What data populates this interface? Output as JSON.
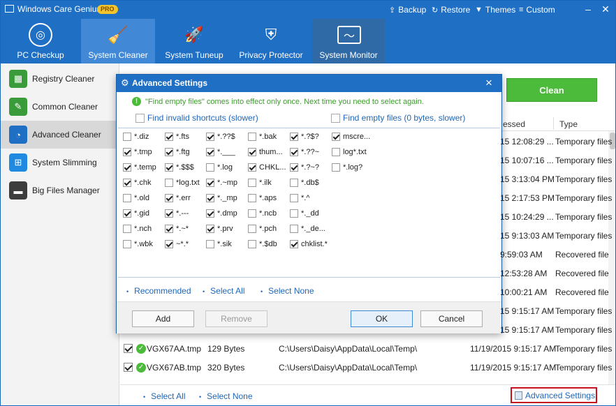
{
  "app": {
    "title": "Windows Care Genius",
    "badge": "PRO",
    "top_links": [
      {
        "label": "Backup",
        "icon": "upload-icon"
      },
      {
        "label": "Restore",
        "icon": "restore-icon"
      },
      {
        "label": "Themes",
        "icon": "shirt-icon"
      },
      {
        "label": "Custom",
        "icon": "list-icon"
      }
    ],
    "accent": "#1f6fc5"
  },
  "nav": {
    "tabs": [
      {
        "label": "PC Checkup",
        "icon": "radar-icon"
      },
      {
        "label": "System Cleaner",
        "icon": "broom-icon"
      },
      {
        "label": "System Tuneup",
        "icon": "rocket-icon"
      },
      {
        "label": "Privacy Protector",
        "icon": "shield-icon"
      },
      {
        "label": "System Monitor",
        "icon": "monitor-icon"
      }
    ]
  },
  "sidebar": {
    "items": [
      {
        "label": "Registry Cleaner",
        "icon": "grid-icon"
      },
      {
        "label": "Common Cleaner",
        "icon": "brush-icon"
      },
      {
        "label": "Advanced Cleaner",
        "icon": "wifi-icon"
      },
      {
        "label": "System Slimming",
        "icon": "windows-icon"
      },
      {
        "label": "Big Files Manager",
        "icon": "folder-icon"
      }
    ]
  },
  "main": {
    "clean_label": "Clean",
    "columns": {
      "accessed": "essed",
      "type": "Type"
    },
    "rows": [
      {
        "date": "15 12:08:29 ...",
        "type": "Temporary files"
      },
      {
        "date": "15 10:07:16 ...",
        "type": "Temporary files"
      },
      {
        "date": "15 3:13:04 PM",
        "type": "Temporary files"
      },
      {
        "date": "15 2:17:53 PM",
        "type": "Temporary files"
      },
      {
        "date": "15 10:24:29 ...",
        "type": "Temporary files"
      },
      {
        "date": "15 9:13:03 AM",
        "type": "Temporary files"
      },
      {
        "date": "9:59:03 AM",
        "type": "Recovered file"
      },
      {
        "date": "12:53:28 AM",
        "type": "Recovered file"
      },
      {
        "date": "10:00:21 AM",
        "type": "Recovered file"
      },
      {
        "date": "15 9:15:17 AM",
        "type": "Temporary files"
      },
      {
        "date": "15 9:15:17 AM",
        "type": "Temporary files"
      }
    ],
    "file_rows": [
      {
        "name": "VGX67AA.tmp",
        "size": "129 Bytes",
        "path": "C:\\Users\\Daisy\\AppData\\Local\\Temp\\",
        "date": "11/19/2015 9:15:17 AM",
        "type": "Temporary files"
      },
      {
        "name": "VGX67AB.tmp",
        "size": "320 Bytes",
        "path": "C:\\Users\\Daisy\\AppData\\Local\\Temp\\",
        "date": "11/19/2015 9:15:17 AM",
        "type": "Temporary files"
      }
    ],
    "select_all": "Select All",
    "select_none": "Select None",
    "advanced_settings": "Advanced Settings"
  },
  "dialog": {
    "title": "Advanced Settings",
    "notice": "\"Find empty files\" comes into effect only once. Next time you need to select again.",
    "opt_shortcuts": "Find invalid shortcuts (slower)",
    "opt_empty": "Find empty files (0 bytes, slower)",
    "patterns": [
      [
        {
          "l": "*.diz",
          "c": false
        },
        {
          "l": "*.fts",
          "c": true
        },
        {
          "l": "*.??$",
          "c": true
        },
        {
          "l": "*.bak",
          "c": false
        },
        {
          "l": "*.?$?",
          "c": true
        },
        {
          "l": "mscre...",
          "c": true
        }
      ],
      [
        {
          "l": "*.tmp",
          "c": true
        },
        {
          "l": "*.ftg",
          "c": true
        },
        {
          "l": "*.___",
          "c": true
        },
        {
          "l": "thum...",
          "c": true
        },
        {
          "l": "*.??~",
          "c": true
        },
        {
          "l": "log*.txt",
          "c": false
        }
      ],
      [
        {
          "l": "*.temp",
          "c": true
        },
        {
          "l": "*.$$$",
          "c": true
        },
        {
          "l": "*.log",
          "c": false
        },
        {
          "l": "CHKL...",
          "c": true
        },
        {
          "l": "*.?~?",
          "c": true
        },
        {
          "l": "*.log?",
          "c": false
        }
      ],
      [
        {
          "l": "*.chk",
          "c": true
        },
        {
          "l": "*log.txt",
          "c": false
        },
        {
          "l": "*.~mp",
          "c": true
        },
        {
          "l": "*.ilk",
          "c": false
        },
        {
          "l": "*.db$",
          "c": false
        }
      ],
      [
        {
          "l": "*.old",
          "c": false
        },
        {
          "l": "*.err",
          "c": true
        },
        {
          "l": "*._mp",
          "c": true
        },
        {
          "l": "*.aps",
          "c": false
        },
        {
          "l": "*.^",
          "c": false
        }
      ],
      [
        {
          "l": "*.gid",
          "c": true
        },
        {
          "l": "*.---",
          "c": true
        },
        {
          "l": "*.dmp",
          "c": true
        },
        {
          "l": "*.ncb",
          "c": false
        },
        {
          "l": "*._dd",
          "c": false
        }
      ],
      [
        {
          "l": "*.nch",
          "c": false
        },
        {
          "l": "*.~*",
          "c": true
        },
        {
          "l": "*.prv",
          "c": true
        },
        {
          "l": "*.pch",
          "c": false
        },
        {
          "l": "*._de...",
          "c": false
        }
      ],
      [
        {
          "l": "*.wbk",
          "c": false
        },
        {
          "l": "~*.*",
          "c": true
        },
        {
          "l": "*.sik",
          "c": false
        },
        {
          "l": "*.$db",
          "c": false
        },
        {
          "l": "chklist.*",
          "c": true
        }
      ]
    ],
    "recommended": "Recommended",
    "select_all": "Select All",
    "select_none": "Select None",
    "add": "Add",
    "remove": "Remove",
    "ok": "OK",
    "cancel": "Cancel"
  }
}
